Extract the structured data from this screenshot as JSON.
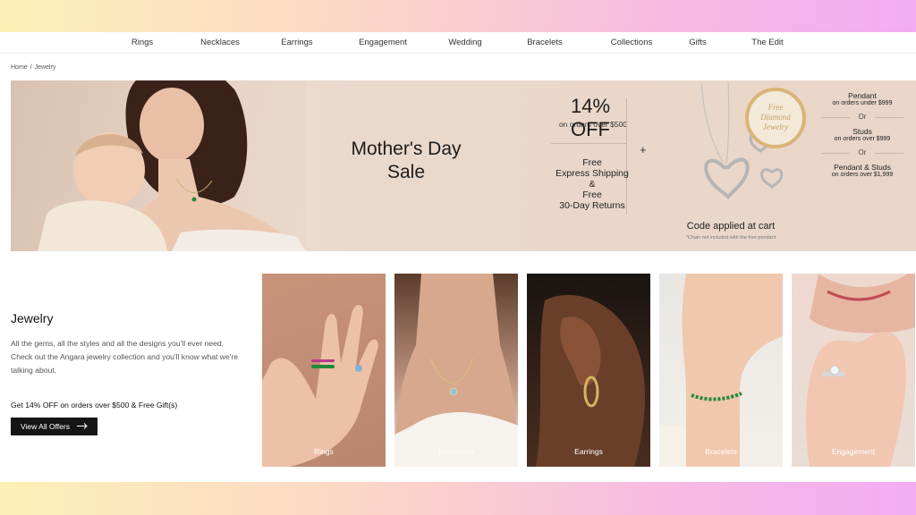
{
  "nav": {
    "items": [
      "Rings",
      "Necklaces",
      "Earrings",
      "Engagement",
      "Wedding",
      "Bracelets",
      "Collections",
      "Gifts",
      "The Edit"
    ]
  },
  "breadcrumb": {
    "home": "Home",
    "separator": "/",
    "current": "Jewelry"
  },
  "hero": {
    "title": "Mother's Day",
    "subtitle": "Sale",
    "offer_percent": "14% OFF",
    "offer_condition": "on orders over $500",
    "plus": "+",
    "shipping_lines": [
      "Free",
      "Express Shipping",
      "&",
      "Free",
      "30-Day Returns"
    ],
    "badge_lines": [
      "Free",
      "Diamond",
      "Jewelry"
    ],
    "code_text": "Code applied at cart",
    "code_note": "*Chain not included with the free pendant",
    "options": [
      {
        "title": "Pendant",
        "sub": "on orders under $999"
      },
      {
        "title": "Studs",
        "sub": "on orders over $999"
      },
      {
        "title": "Pendant & Studs",
        "sub": "on orders over $1,999"
      }
    ],
    "or_label": "Or"
  },
  "intro": {
    "title": "Jewelry",
    "description": "All the gems, all the styles and all the designs you'll ever need. Check out the Angara jewelry collection and you'll know what we're talking about.",
    "offer": "Get 14% OFF on orders over $500 & Free Gift(s)",
    "button_label": "View All Offers"
  },
  "categories": [
    {
      "label": "Rings"
    },
    {
      "label": "Necklaces"
    },
    {
      "label": "Earrings"
    },
    {
      "label": "Bracelets"
    },
    {
      "label": "Engagement"
    }
  ],
  "colors": {
    "hero_bg": "#ead8cb",
    "badge_gold": "#d9b478",
    "button_dark": "#151515",
    "emerald": "#1f8a3a"
  }
}
